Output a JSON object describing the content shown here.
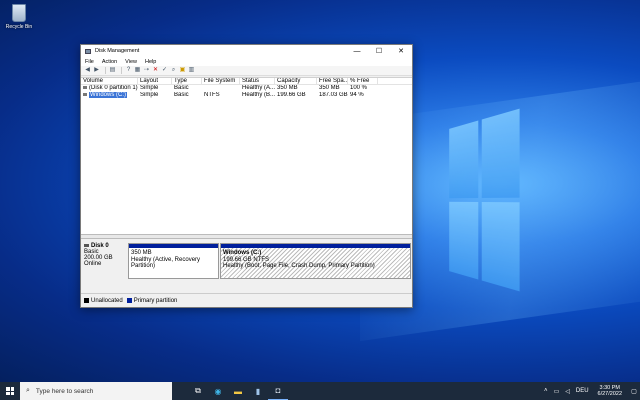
{
  "desktop": {
    "recycle_bin_label": "Recycle Bin"
  },
  "window": {
    "title": "Disk Management",
    "controls": {
      "minimize": "—",
      "maximize": "☐",
      "close": "✕"
    },
    "menu": [
      "File",
      "Action",
      "View",
      "Help"
    ],
    "toolbar_icons": [
      "back-icon",
      "forward-icon",
      "list-icon",
      "help-icon",
      "properties-icon",
      "connect-icon",
      "delete-icon",
      "check-icon",
      "explore-icon",
      "disk-icon",
      "view-icon"
    ],
    "columns": [
      "Volume",
      "Layout",
      "Type",
      "File System",
      "Status",
      "Capacity",
      "Free Spa...",
      "% Free"
    ],
    "rows": [
      [
        "(Disk 0 partition 1)",
        "Simple",
        "Basic",
        "",
        "Healthy (A...",
        "350 MB",
        "350 MB",
        "100 %"
      ],
      [
        "Windows (C:)",
        "Simple",
        "Basic",
        "NTFS",
        "Healthy (B...",
        "199.66 GB",
        "187.03 GB",
        "94 %"
      ]
    ],
    "disk": {
      "name": "Disk 0",
      "type": "Basic",
      "size": "200.00 GB",
      "status": "Online"
    },
    "partitions": [
      {
        "title": "",
        "size": "350 MB",
        "status": "Healthy (Active, Recovery Partition)"
      },
      {
        "title": "Windows (C:)",
        "size": "199.66 GB NTFS",
        "status": "Healthy (Boot, Page File, Crash Dump, Primary Partition)"
      }
    ],
    "legend": [
      {
        "label": "Unallocated",
        "color": "#000000"
      },
      {
        "label": "Primary partition",
        "color": "#001f9c"
      }
    ]
  },
  "taskbar": {
    "search_placeholder": "Type here to search",
    "apps": [
      "task-view-icon",
      "edge-icon",
      "file-explorer-icon",
      "server-manager-icon",
      "disk-management-icon"
    ],
    "tray": {
      "lang": "DEU",
      "time": "3:30 PM",
      "date": "6/27/2022"
    }
  }
}
